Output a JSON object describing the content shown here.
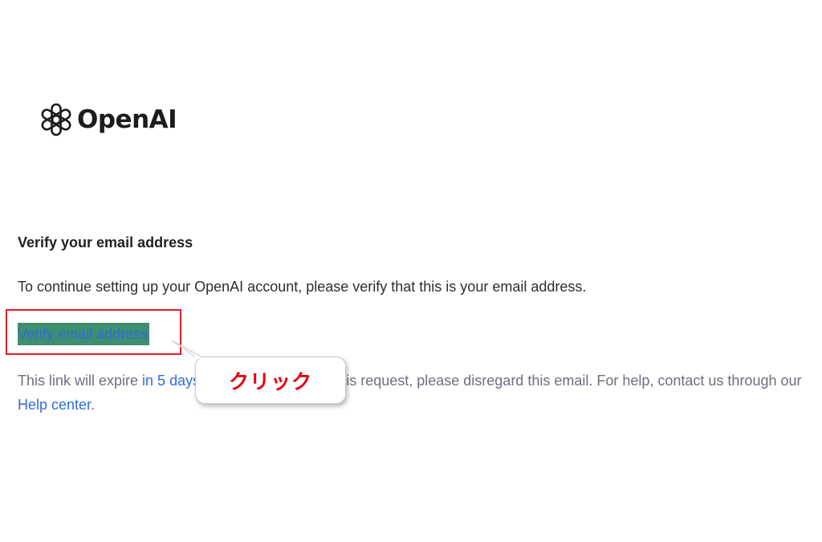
{
  "brand": {
    "name": "OpenAI",
    "logo_icon": "openai-logo-icon"
  },
  "email": {
    "heading": "Verify your email address",
    "body": "To continue setting up your OpenAI account, please verify that this is your email address.",
    "button_label": "Verify email address",
    "footer": {
      "prefix": "This link will expire ",
      "expire_link": "in 5 days",
      "middle": ". If you did not make this request, please disregard this email. For help, contact us through our ",
      "help_link": "Help center",
      "suffix": "."
    }
  },
  "annotation": {
    "callout_label": "クリック",
    "highlight_color": "#e01e25",
    "callout_text_color": "#e60012"
  },
  "colors": {
    "link": "#2f6be0",
    "button_bg": "#3f8f6e",
    "heading": "#202123",
    "muted": "#6e6e80"
  }
}
